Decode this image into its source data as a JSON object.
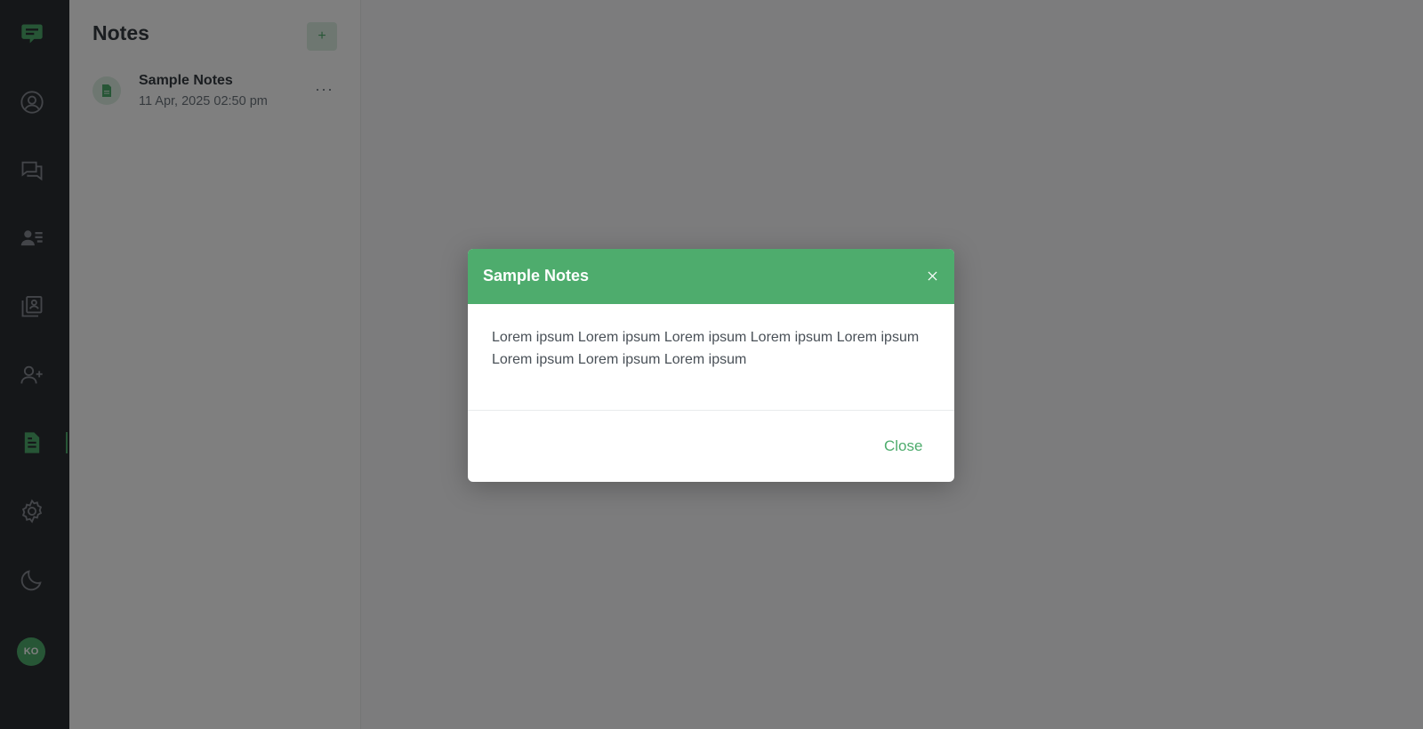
{
  "rail": {
    "items": [
      {
        "icon": "chat-logo-icon"
      },
      {
        "icon": "profile-icon"
      },
      {
        "icon": "chats-icon"
      },
      {
        "icon": "contacts-icon"
      },
      {
        "icon": "bookmarks-icon"
      },
      {
        "icon": "add-contact-icon"
      },
      {
        "icon": "notes-icon"
      },
      {
        "icon": "settings-icon"
      },
      {
        "icon": "dark-mode-icon"
      }
    ],
    "avatar_initials": "KO",
    "accent_color": "#4eac6d"
  },
  "notes": {
    "title": "Notes",
    "add_label": "+",
    "items": [
      {
        "name": "Sample Notes",
        "date": "11 Apr, 2025 02:50 pm",
        "more": "···"
      }
    ]
  },
  "modal": {
    "title": "Sample Notes",
    "body": "Lorem ipsum Lorem ipsum Lorem ipsum Lorem ipsum Lorem ipsum Lorem ipsum Lorem ipsum Lorem ipsum",
    "close_label": "Close",
    "header_color": "#4eac6d"
  }
}
